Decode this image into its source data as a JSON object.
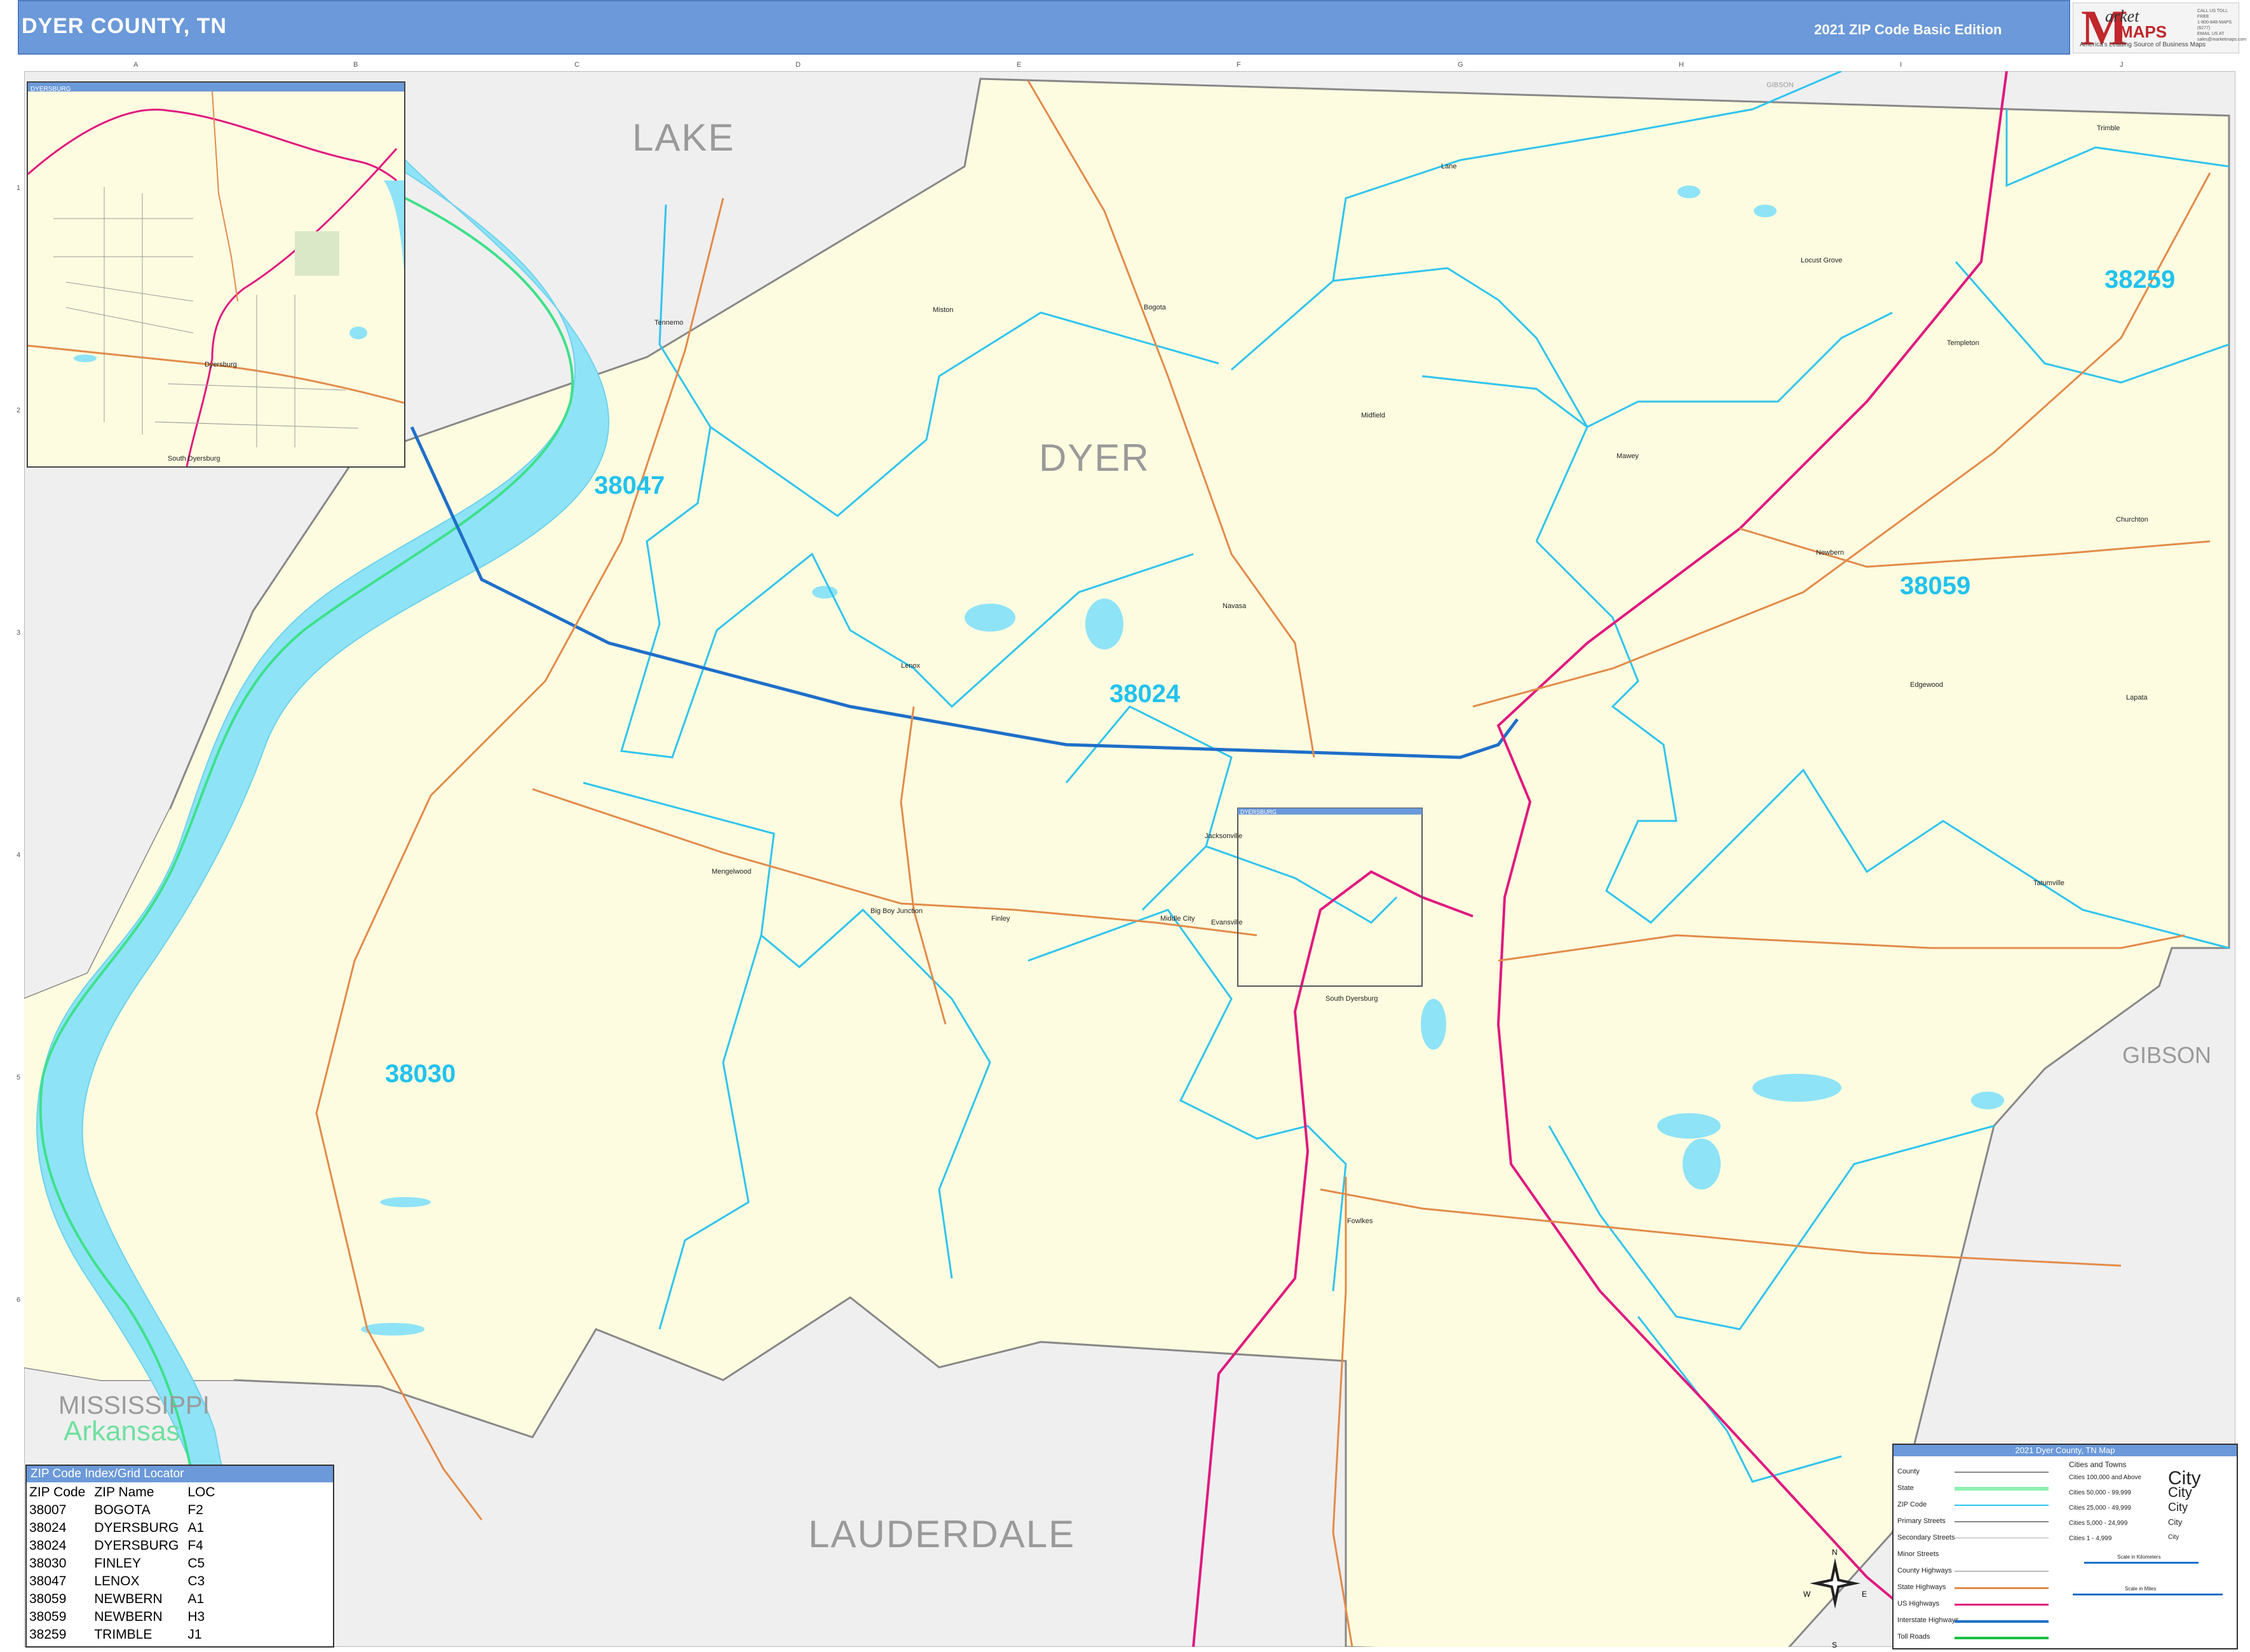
{
  "header": {
    "title": "DYER COUNTY, TN",
    "edition": "2021 ZIP Code Basic Edition"
  },
  "logo": {
    "letter": "M",
    "market": "arket",
    "maps": "MAPS",
    "tagline": "America's Leading Source of Business Maps",
    "contact": [
      "CALL US TOLL FREE",
      "1-800-848-MAPS (6277)",
      "EMAIL US AT",
      "sales@marketmaps.com"
    ]
  },
  "counties": {
    "lake": "LAKE",
    "dyer": "DYER",
    "gibson": "GIBSON",
    "gibson_small": "GIBSON",
    "lauderdale": "LAUDERDALE",
    "mississippi": "MISSISSIPPI",
    "arkansas": "Arkansas"
  },
  "zip_labels": [
    "38259",
    "38047",
    "38024",
    "38059",
    "38030"
  ],
  "towns": [
    "Tennemo",
    "Miston",
    "Bogota",
    "Lane",
    "Locust Grove",
    "Trimble",
    "Templeton",
    "Midfield",
    "Mawey",
    "Newbern",
    "Churchton",
    "Edgewood",
    "Lapata",
    "Lenox",
    "Navasa",
    "Jacksonville",
    "Mengelwood",
    "Big Boy Junction",
    "Finley",
    "Middle City",
    "Evansville",
    "South Dyersburg",
    "Tatumville",
    "Fowlkes"
  ],
  "grid": {
    "cols": [
      "A",
      "B",
      "C",
      "D",
      "E",
      "F",
      "G",
      "H",
      "I",
      "J"
    ],
    "rows": [
      "1",
      "2",
      "3",
      "4",
      "5",
      "6"
    ]
  },
  "inset": {
    "title": "DYERSBURG",
    "towns": [
      "Dyersburg",
      "South Dyersburg"
    ]
  },
  "main_inset_marker": "DYERSBURG",
  "zip_index": {
    "title": "ZIP Code Index/Grid Locator",
    "columns": [
      "ZIP Code",
      "ZIP Name",
      "LOC"
    ],
    "rows": [
      [
        "38007",
        "BOGOTA",
        "F2"
      ],
      [
        "38024",
        "DYERSBURG",
        "A1"
      ],
      [
        "38024",
        "DYERSBURG",
        "F4"
      ],
      [
        "38030",
        "FINLEY",
        "C5"
      ],
      [
        "38047",
        "LENOX",
        "C3"
      ],
      [
        "38059",
        "NEWBERN",
        "A1"
      ],
      [
        "38059",
        "NEWBERN",
        "H3"
      ],
      [
        "38259",
        "TRIMBLE",
        "J1"
      ]
    ]
  },
  "legend": {
    "title": "2021 Dyer County, TN Map",
    "lines": [
      "County",
      "State",
      "ZIP Code",
      "Primary Streets",
      "Secondary Streets",
      "Minor Streets",
      "County Highways",
      "State Highways",
      "US Highways",
      "Interstate Highways",
      "Toll Roads"
    ],
    "cities_title": "Cities and Towns",
    "cities": [
      "Cities 100,000 and Above",
      "Cities 50,000 - 99,999",
      "Cities 25,000 - 49,999",
      "Cities 5,000 - 24,999",
      "Cities 1 - 4,999"
    ],
    "city_word": "City",
    "scale_km": "Scale in Kilometers",
    "scale_mi": "Scale in Miles"
  },
  "compass": {
    "n": "N",
    "s": "S",
    "e": "E",
    "w": "W"
  },
  "colors": {
    "header": "#6b99d9",
    "land": "#fdfce0",
    "neighbor": "#efefef",
    "water": "#8fe3f7",
    "zip_boundary": "#30c4ee",
    "interstate": "#1f6fc9",
    "us_highway": "#e0197f",
    "state_highway": "#e28b4a",
    "state_line": "#3ee08a"
  }
}
